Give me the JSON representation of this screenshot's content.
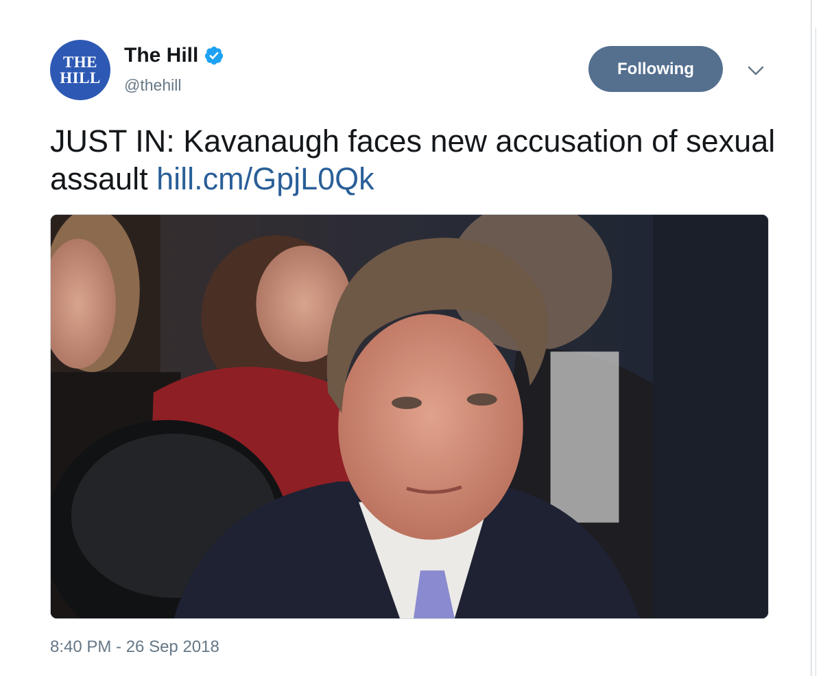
{
  "tweet": {
    "author": {
      "display_name": "The Hill",
      "handle": "@thehill",
      "avatar_text": [
        "THE",
        "HILL"
      ],
      "verified": true
    },
    "follow_button_label": "Following",
    "text": "JUST IN: Kavanaugh faces new accusation of sexual assault ",
    "link": "hill.cm/GpjL0Qk",
    "timestamp": "8:40 PM - 26 Sep 2018"
  },
  "icons": {
    "verified": "verified-badge-icon",
    "caret": "chevron-down-icon"
  },
  "colors": {
    "avatar_bg": "#2d59b5",
    "follow_button_bg": "#55708f",
    "link": "#2a5f98",
    "secondary_text": "#657786",
    "verified_blue": "#1da1f2"
  }
}
